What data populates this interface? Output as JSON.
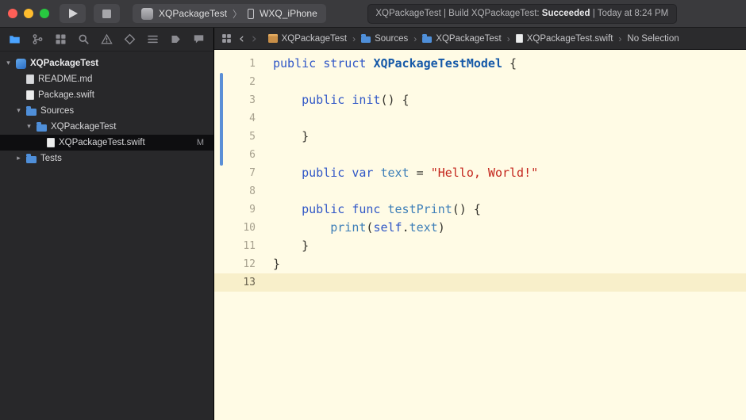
{
  "colors": {
    "toolbar_bg": "#3a3a3d",
    "sidebar_bg": "#28282a",
    "jumpbar_bg": "#2b2b2d",
    "editor_bg": "#fffbe5",
    "current_line_bg": "#f8efca",
    "selected_row_bg": "#0e0e10",
    "accent_blue": "#4aa3ff",
    "folder_blue": "#4f8fd9",
    "change_bar": "#5b8fd6",
    "kw": "#3057c7",
    "type_name": "#1458a8",
    "member": "#3e7fb8",
    "string": "#c4261d",
    "plain": "#33322c",
    "line_number": "#a8a28f",
    "traffic_red": "#ff5f57",
    "traffic_yellow": "#febc2e",
    "traffic_green": "#28c840"
  },
  "toolbar": {
    "scheme": {
      "name": "XQPackageTest",
      "device": "WXQ_iPhone"
    },
    "status": {
      "pre": "XQPackageTest | Build XQPackageTest: ",
      "result": "Succeeded",
      "post": " | Today at 8:24 PM"
    }
  },
  "sidebar": {
    "navigator_icons": [
      {
        "name": "project-navigator",
        "active": true
      },
      {
        "name": "source-control-navigator",
        "active": false
      },
      {
        "name": "symbol-navigator",
        "active": false
      },
      {
        "name": "find-navigator",
        "active": false
      },
      {
        "name": "issue-navigator",
        "active": false
      },
      {
        "name": "test-navigator",
        "active": false
      },
      {
        "name": "debug-navigator",
        "active": false
      },
      {
        "name": "breakpoint-navigator",
        "active": false
      },
      {
        "name": "report-navigator",
        "active": false
      }
    ],
    "tree": [
      {
        "label": "XQPackageTest",
        "level": 0,
        "disc": "open",
        "icon": "project",
        "selected": false,
        "badge": ""
      },
      {
        "label": "README.md",
        "level": 1,
        "disc": null,
        "icon": "doc",
        "selected": false,
        "badge": ""
      },
      {
        "label": "Package.swift",
        "level": 1,
        "disc": null,
        "icon": "swift",
        "selected": false,
        "badge": ""
      },
      {
        "label": "Sources",
        "level": 1,
        "disc": "open",
        "icon": "folder",
        "selected": false,
        "badge": ""
      },
      {
        "label": "XQPackageTest",
        "level": 2,
        "disc": "open",
        "icon": "folder",
        "selected": false,
        "badge": ""
      },
      {
        "label": "XQPackageTest.swift",
        "level": 3,
        "disc": null,
        "icon": "swift",
        "selected": true,
        "badge": "M"
      },
      {
        "label": "Tests",
        "level": 1,
        "disc": "closed",
        "icon": "folder",
        "selected": false,
        "badge": ""
      }
    ]
  },
  "jumpbar": {
    "items": [
      {
        "label": "XQPackageTest",
        "icon": "package"
      },
      {
        "label": "Sources",
        "icon": "folder"
      },
      {
        "label": "XQPackageTest",
        "icon": "folder"
      },
      {
        "label": "XQPackageTest.swift",
        "icon": "swift"
      },
      {
        "label": "No Selection",
        "icon": null
      }
    ]
  },
  "editor": {
    "current_line": 13,
    "lines": [
      {
        "num": 1,
        "segments": [
          {
            "t": "public struct ",
            "c": "kw"
          },
          {
            "t": "XQPackageTestModel",
            "c": "type"
          },
          {
            "t": " {",
            "c": "pl"
          }
        ]
      },
      {
        "num": 2,
        "segments": []
      },
      {
        "num": 3,
        "segments": [
          {
            "t": "    ",
            "c": "pl"
          },
          {
            "t": "public init",
            "c": "kw"
          },
          {
            "t": "() {",
            "c": "pl"
          }
        ]
      },
      {
        "num": 4,
        "segments": []
      },
      {
        "num": 5,
        "segments": [
          {
            "t": "    }",
            "c": "pl"
          }
        ]
      },
      {
        "num": 6,
        "segments": []
      },
      {
        "num": 7,
        "segments": [
          {
            "t": "    ",
            "c": "pl"
          },
          {
            "t": "public var ",
            "c": "kw"
          },
          {
            "t": "text",
            "c": "id"
          },
          {
            "t": " = ",
            "c": "pl"
          },
          {
            "t": "\"Hello, World!\"",
            "c": "str"
          }
        ]
      },
      {
        "num": 8,
        "segments": []
      },
      {
        "num": 9,
        "segments": [
          {
            "t": "    ",
            "c": "pl"
          },
          {
            "t": "public func ",
            "c": "kw"
          },
          {
            "t": "testPrint",
            "c": "fn"
          },
          {
            "t": "() {",
            "c": "pl"
          }
        ]
      },
      {
        "num": 10,
        "segments": [
          {
            "t": "        ",
            "c": "pl"
          },
          {
            "t": "print",
            "c": "fn"
          },
          {
            "t": "(",
            "c": "pl"
          },
          {
            "t": "self",
            "c": "kw"
          },
          {
            "t": ".",
            "c": "pl"
          },
          {
            "t": "text",
            "c": "id"
          },
          {
            "t": ")",
            "c": "pl"
          }
        ]
      },
      {
        "num": 11,
        "segments": [
          {
            "t": "    }",
            "c": "pl"
          }
        ]
      },
      {
        "num": 12,
        "segments": [
          {
            "t": "}",
            "c": "pl"
          }
        ]
      },
      {
        "num": 13,
        "segments": []
      }
    ]
  }
}
